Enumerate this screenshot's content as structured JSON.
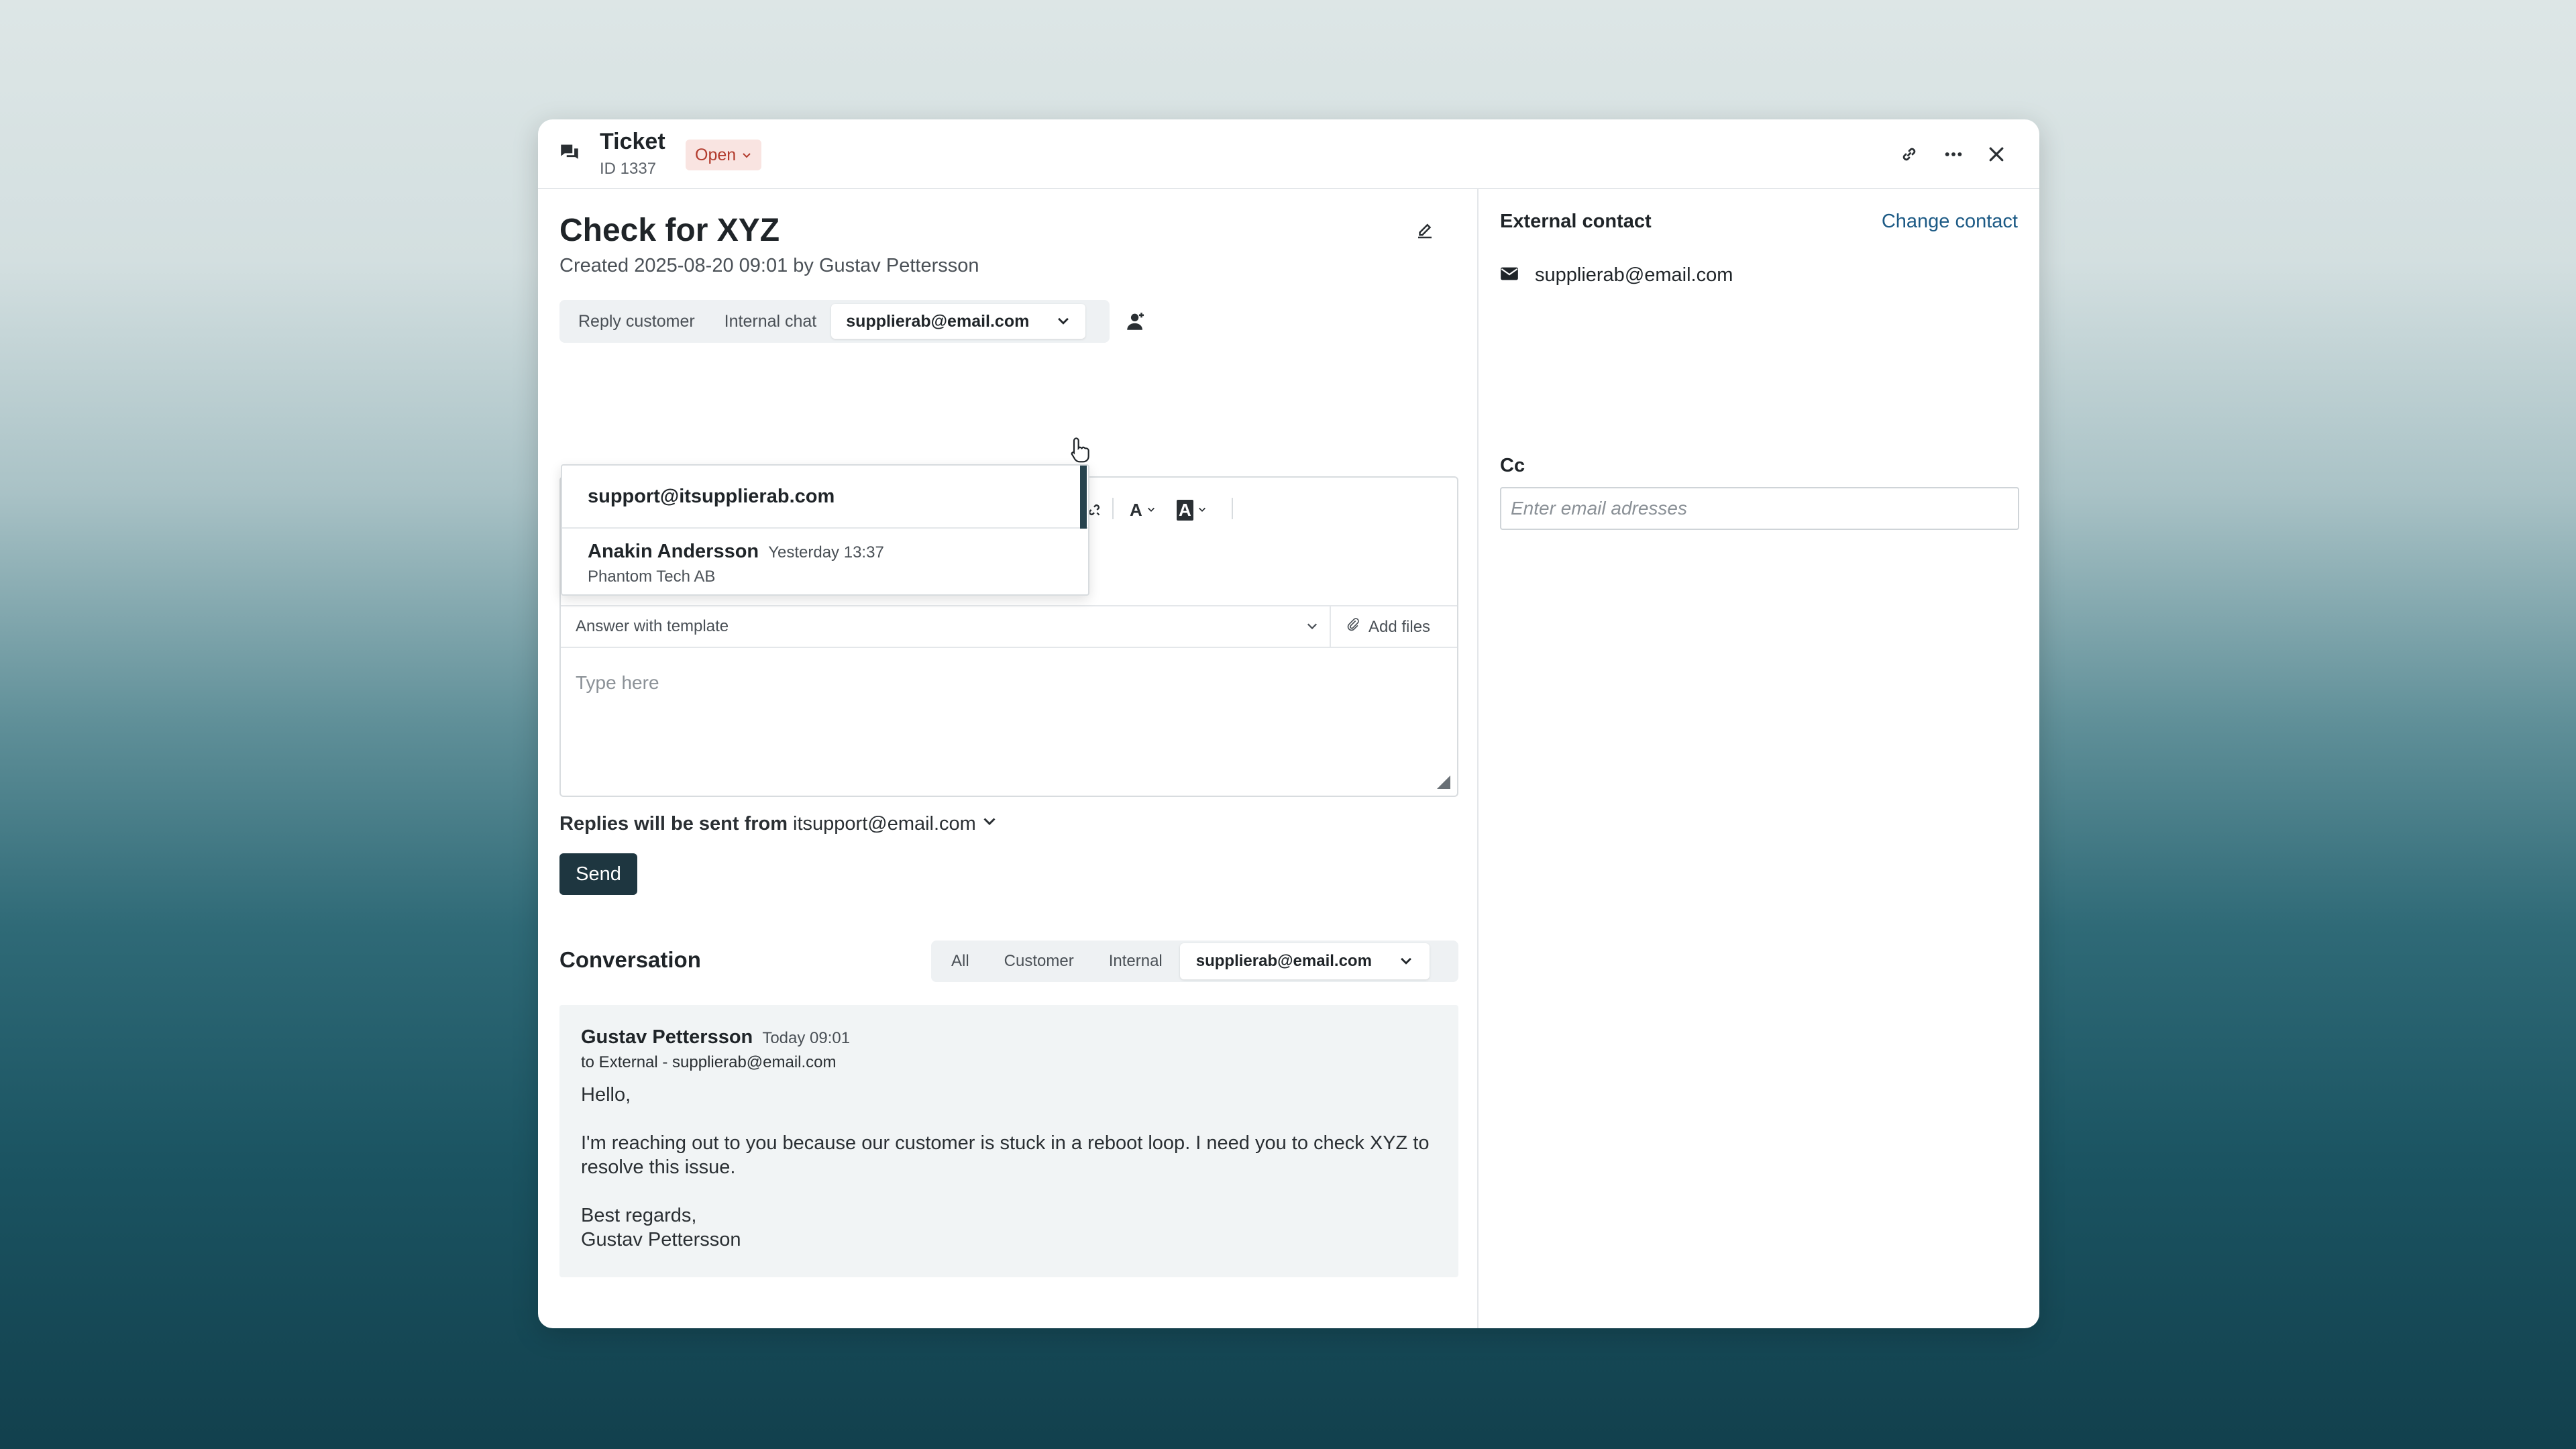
{
  "header": {
    "title": "Ticket",
    "id_label": "ID 1337",
    "status": "Open"
  },
  "main": {
    "title": "Check for XYZ",
    "created": "Created 2025-08-20 09:01 by Gustav Pettersson",
    "tabs": [
      {
        "label": "Reply customer"
      },
      {
        "label": "Internal chat"
      },
      {
        "label": "supplierab@email.com",
        "active": true
      }
    ],
    "dropdown": {
      "first_option": "support@itsupplierab.com",
      "second_option": {
        "name": "Anakin Andersson",
        "time": "Yesterday 13:37",
        "company": "Phantom Tech AB"
      }
    },
    "toolbar": {
      "text_color": "A",
      "highlight": "A"
    },
    "template_placeholder": "Answer with template",
    "add_files": "Add files",
    "message_placeholder": "Type here",
    "reply_from_label": "Replies will be sent from",
    "reply_from_value": "itsupport@email.com",
    "send_label": "Send"
  },
  "conversation": {
    "title": "Conversation",
    "filters": [
      "All",
      "Customer",
      "Internal",
      "supplierab@email.com"
    ],
    "message": {
      "author": "Gustav Pettersson",
      "time": "Today 09:01",
      "to": "to External - supplierab@email.com",
      "greeting": "Hello,",
      "body": "I'm reaching out to you because our customer is stuck in a reboot loop. I need you to check XYZ to resolve this issue.",
      "signoff": "Best regards,",
      "signature": "Gustav Pettersson"
    }
  },
  "sidebar": {
    "title": "External contact",
    "change_contact": "Change contact",
    "email": "supplierab@email.com",
    "cc_label": "Cc",
    "cc_placeholder": "Enter email adresses"
  },
  "colors": {
    "accent_dark": "#1e3640",
    "link": "#1c5a85",
    "status_bg": "#f9e4e1",
    "status_text": "#b23a2c"
  },
  "icons": [
    "ticket-icon",
    "chevron-down-icon",
    "link-icon",
    "more-icon",
    "close-icon",
    "edit-icon",
    "assign-user-icon",
    "paperclip-icon",
    "mail-icon",
    "cursor-icon"
  ]
}
